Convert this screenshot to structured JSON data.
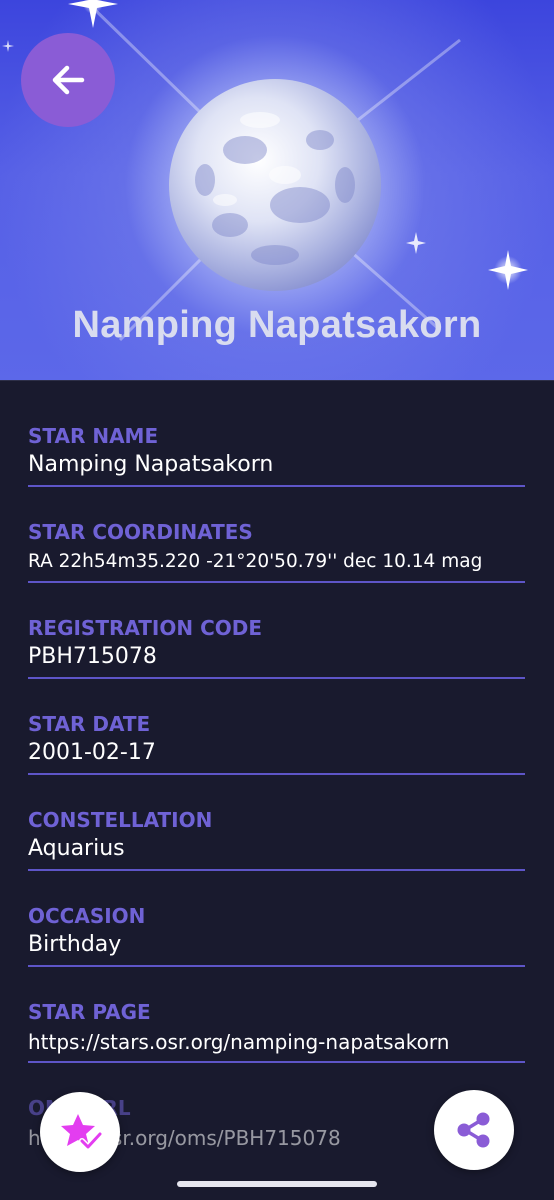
{
  "hero": {
    "title": "Namping Napatsakorn"
  },
  "icons": {
    "back": "arrow-left-icon",
    "favorite": "star-check-icon",
    "share": "share-icon"
  },
  "colors": {
    "accent": "#6f62d5",
    "back_button": "#8a5cd6",
    "background": "#191a2e",
    "favorite_icon": "#e33df0",
    "share_icon": "#8a5cd6"
  },
  "details": [
    {
      "label": "STAR NAME",
      "value": "Namping Napatsakorn"
    },
    {
      "label": "STAR COORDINATES",
      "value": "RA 22h54m35.220 -21°20'50.79'' dec 10.14 mag"
    },
    {
      "label": "REGISTRATION CODE",
      "value": "PBH715078"
    },
    {
      "label": "STAR DATE",
      "value": "2001-02-17"
    },
    {
      "label": "CONSTELLATION",
      "value": "Aquarius"
    },
    {
      "label": "OCCASION",
      "value": "Birthday"
    },
    {
      "label": "STAR PAGE",
      "value": "https://stars.osr.org/namping-napatsakorn"
    },
    {
      "label": "OMS URL",
      "value": "https://osr.org/oms/PBH715078"
    }
  ]
}
